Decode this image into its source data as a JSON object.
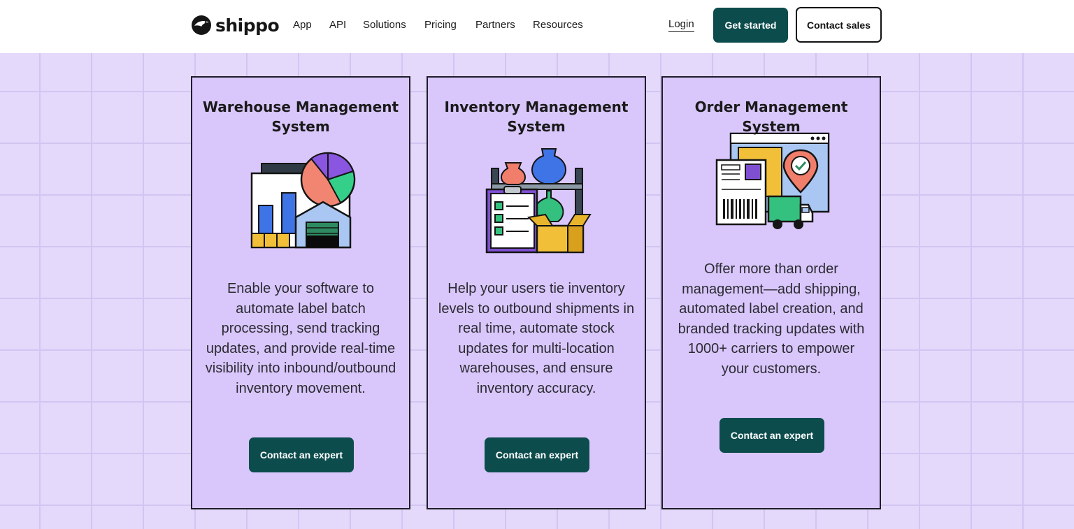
{
  "header": {
    "logo_text": "shippo",
    "nav": [
      "App",
      "API",
      "Solutions",
      "Pricing",
      "Partners",
      "Resources"
    ],
    "login": "Login",
    "get_started": "Get started",
    "contact_sales": "Contact sales"
  },
  "cards": [
    {
      "title_line1": "Warehouse Management",
      "title_line2": "System",
      "description": "Enable your software to automate label batch processing, send tracking updates, and provide real-time visibility into inbound/outbound inventory movement.",
      "button": "Contact an expert",
      "icon": "warehouse-chart-illustration"
    },
    {
      "title_line1": "Inventory Management",
      "title_line2": "System",
      "description": "Help your users tie inventory levels to outbound shipments in real time, automate stock updates for multi-location warehouses, and ensure inventory accuracy.",
      "button": "Contact an expert",
      "icon": "inventory-shelf-illustration"
    },
    {
      "title_line1": "Order Management System",
      "title_line2": "",
      "description": "Offer more than order management—add shipping, automated label creation, and branded tracking updates with 1000+ carriers to empower your customers.",
      "button": "Contact an expert",
      "icon": "order-label-truck-illustration"
    }
  ],
  "colors": {
    "brand_dark": "#0d4c4d",
    "page_bg": "#e4d8fb",
    "card_bg": "#d9c7fb"
  }
}
